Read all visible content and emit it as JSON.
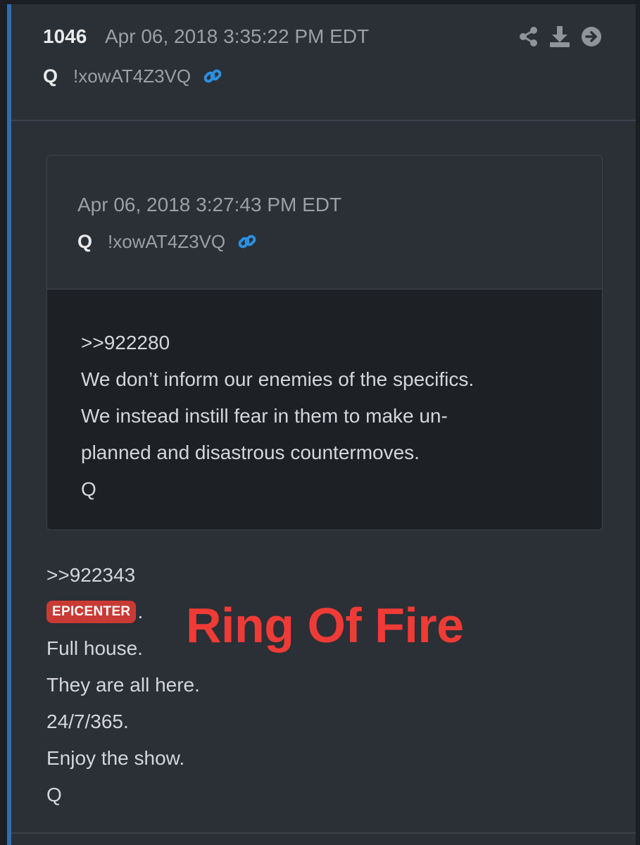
{
  "post": {
    "number": "1046",
    "date": "Apr 06, 2018 3:35:22 PM EDT",
    "author": "Q",
    "tripcode": "!xowAT4Z3VQ",
    "actions": [
      "share-icon",
      "download-icon",
      "forward-arrow-icon"
    ]
  },
  "quoted_post": {
    "date": "Apr 06, 2018 3:27:43 PM EDT",
    "author": "Q",
    "tripcode": "!xowAT4Z3VQ",
    "lines": [
      ">>922280",
      "We don’t inform our enemies of the specifics.",
      "We instead instill fear in them to make un-",
      "planned and disastrous countermoves.",
      "Q"
    ]
  },
  "body": {
    "reply_ref": ">>922343",
    "badge": "EPICENTER",
    "badge_suffix": ".",
    "lines": [
      "Full house.",
      "They are all here.",
      "24/7/365.",
      "Enjoy the show.",
      "Q"
    ]
  },
  "overlay": {
    "caption": "Ring Of Fire"
  },
  "colors": {
    "accent_border": "#2f6db3",
    "link": "#2b8fe0",
    "badge": "#c93a34",
    "caption": "#ef3b36"
  }
}
